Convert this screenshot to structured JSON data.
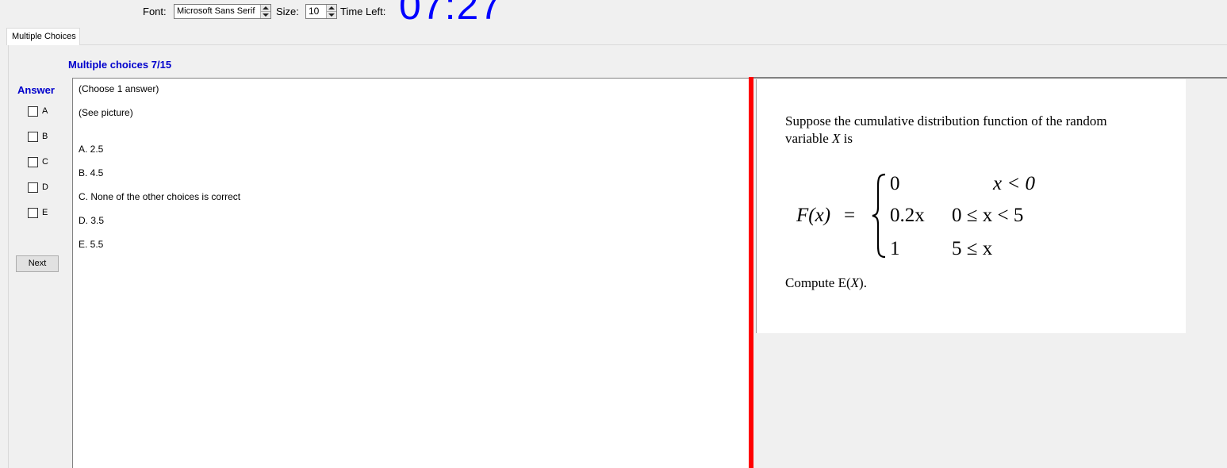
{
  "toolbar": {
    "font_label": "Font:",
    "font_value": "Microsoft Sans Serif",
    "size_label": "Size:",
    "size_value": "10",
    "time_label": "Time Left:",
    "timer": "07:27"
  },
  "tab": {
    "label": "Multiple Choices"
  },
  "section_title": "Multiple choices 7/15",
  "answer": {
    "label": "Answer",
    "options": [
      "A",
      "B",
      "C",
      "D",
      "E"
    ],
    "next_label": "Next"
  },
  "question": {
    "instruction": "(Choose 1 answer)",
    "see_picture": "(See picture)",
    "choices": [
      "A.  2.5",
      "B.  4.5",
      "C.  None of the other choices is correct",
      "D.  3.5",
      "E.  5.5"
    ]
  },
  "picture": {
    "line1": "Suppose the cumulative distribution function of the random",
    "line2_prefix": "variable ",
    "line2_var": "X",
    "line2_suffix": " is",
    "lhs": "F(x)",
    "equals": "=",
    "cases": [
      {
        "value": "0",
        "condition": "x < 0"
      },
      {
        "value": "0.2x",
        "condition": "0 ≤ x < 5"
      },
      {
        "value": "1",
        "condition": "5 ≤ x"
      }
    ],
    "compute_prefix": "Compute E(",
    "compute_var": "X",
    "compute_suffix": ")."
  },
  "colors": {
    "accent": "#0000cc",
    "timer": "#0000ff",
    "divider": "#ff0000"
  }
}
